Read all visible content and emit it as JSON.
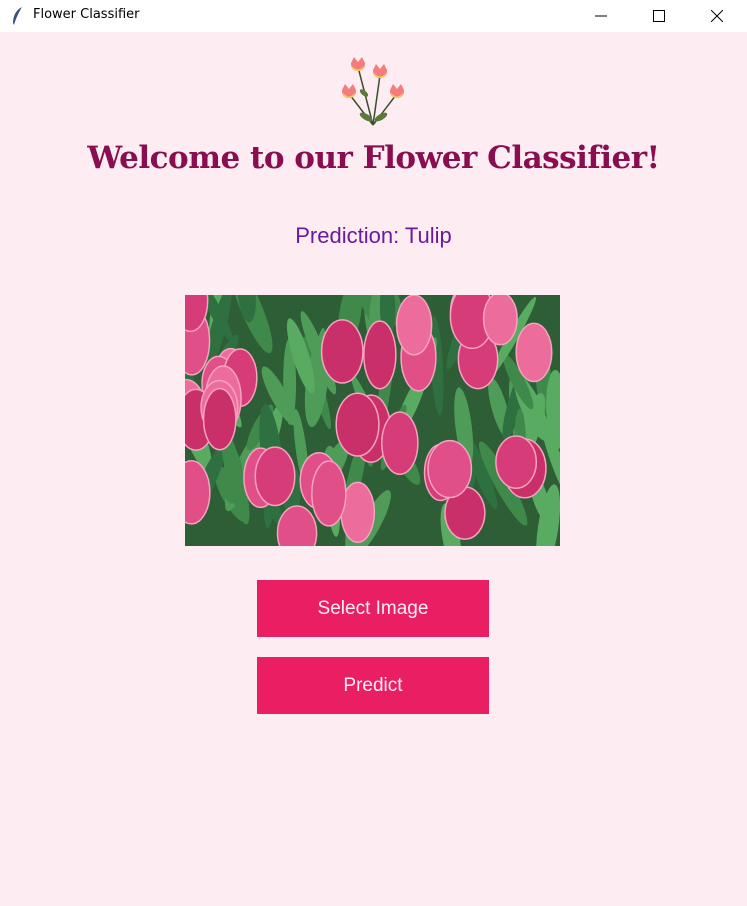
{
  "window": {
    "title": "Flower Classifier",
    "controls": [
      "minimize-icon",
      "maximize-icon",
      "close-icon"
    ]
  },
  "header": {
    "logo_icon": "tulip-bouquet-icon",
    "title": "Welcome to our Flower Classifier!"
  },
  "prediction": {
    "text": "Prediction: Tulip"
  },
  "image": {
    "subject": "tulip-photo"
  },
  "buttons": {
    "select_image": "Select Image",
    "predict": "Predict"
  },
  "colors": {
    "background": "#fdedf3",
    "title": "#880e4f",
    "prediction": "#6a1b9a",
    "button": "#e91e63",
    "button_text": "#fdeef3"
  }
}
